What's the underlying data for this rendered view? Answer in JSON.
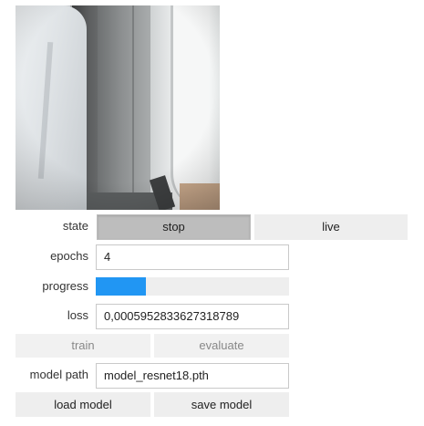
{
  "labels": {
    "state": "state",
    "epochs": "epochs",
    "progress": "progress",
    "loss": "loss",
    "model_path": "model path"
  },
  "state": {
    "options": [
      "stop",
      "live"
    ],
    "selected": "stop"
  },
  "fields": {
    "epochs_value": "4",
    "loss_value": "0,0005952833627318789",
    "model_path_value": "model_resnet18.pth"
  },
  "progress": {
    "value_fraction": 0.26,
    "fill_color": "#2196f3"
  },
  "buttons": {
    "train": "train",
    "evaluate": "evaluate",
    "load_model": "load model",
    "save_model": "save model"
  },
  "camera": {
    "description_icon": "camera-feed"
  }
}
